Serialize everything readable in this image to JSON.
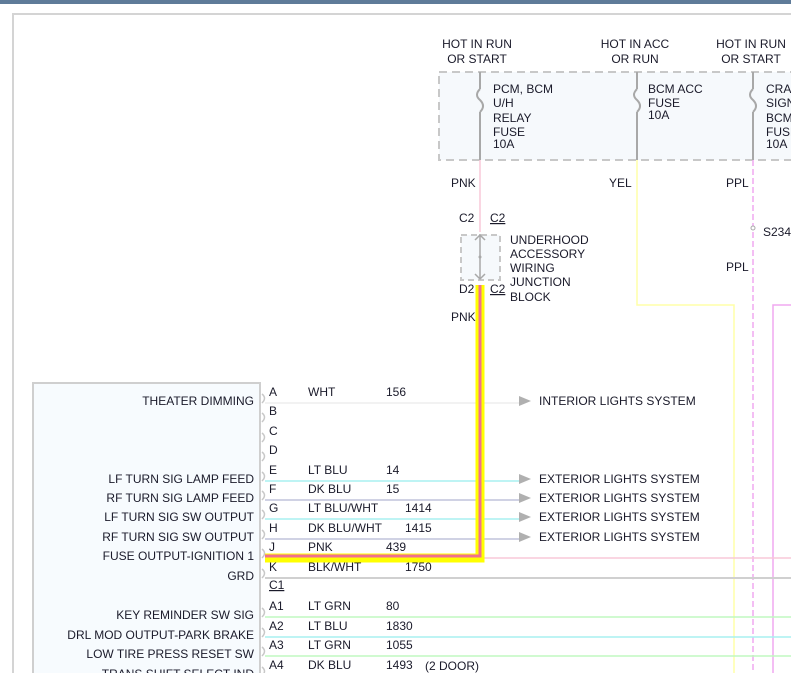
{
  "power_sources": [
    {
      "line1": "HOT IN RUN",
      "line2": "OR START"
    },
    {
      "line1": "HOT IN ACC",
      "line2": "OR RUN"
    },
    {
      "line1": "HOT IN RUN",
      "line2": "OR START"
    }
  ],
  "fuses": [
    {
      "lines": [
        "PCM, BCM",
        "U/H",
        "RELAY",
        "FUSE",
        "10A"
      ]
    },
    {
      "lines": [
        "BCM ACC",
        "FUSE",
        "10A"
      ]
    },
    {
      "lines": [
        "CRANK",
        "SIGNAL",
        "BCM",
        "FUSE",
        "10A"
      ]
    }
  ],
  "wire_labels": {
    "pnk_top": "PNK",
    "yel": "YEL",
    "ppl_top": "PPL",
    "splice": "S234",
    "ppl_bottom": "PPL",
    "pnk_bottom": "PNK"
  },
  "junction_block": {
    "conn_top_left": "C2",
    "conn_top_right": "C2",
    "conn_bottom_left": "D2",
    "conn_bottom_right": "C2",
    "name_lines": [
      "UNDERHOOD",
      "ACCESSORY",
      "WIRING",
      "JUNCTION",
      "BLOCK"
    ]
  },
  "module": {
    "pins": [
      {
        "pin": "A",
        "function": "THEATER DIMMING",
        "color": "WHT",
        "circuit": "156",
        "dest": "INTERIOR LIGHTS SYSTEM",
        "note": ""
      },
      {
        "pin": "B",
        "function": "",
        "color": "",
        "circuit": "",
        "dest": "",
        "note": ""
      },
      {
        "pin": "C",
        "function": "",
        "color": "",
        "circuit": "",
        "dest": "",
        "note": ""
      },
      {
        "pin": "D",
        "function": "",
        "color": "",
        "circuit": "",
        "dest": "",
        "note": ""
      },
      {
        "pin": "E",
        "function": "LF TURN SIG LAMP FEED",
        "color": "LT BLU",
        "circuit": "14",
        "dest": "EXTERIOR LIGHTS SYSTEM",
        "note": ""
      },
      {
        "pin": "F",
        "function": "RF TURN SIG LAMP FEED",
        "color": "DK BLU",
        "circuit": "15",
        "dest": "EXTERIOR LIGHTS SYSTEM",
        "note": ""
      },
      {
        "pin": "G",
        "function": "LF TURN SIG SW OUTPUT",
        "color": "LT BLU/WHT",
        "circuit": "1414",
        "dest": "EXTERIOR LIGHTS SYSTEM",
        "note": ""
      },
      {
        "pin": "H",
        "function": "RF TURN SIG SW OUTPUT",
        "color": "DK BLU/WHT",
        "circuit": "1415",
        "dest": "EXTERIOR LIGHTS SYSTEM",
        "note": ""
      },
      {
        "pin": "J",
        "function": "FUSE OUTPUT-IGNITION 1",
        "color": "PNK",
        "circuit": "439",
        "dest": "",
        "note": ""
      },
      {
        "pin": "K",
        "function": "GRD",
        "color": "BLK/WHT",
        "circuit": "1750",
        "dest": "",
        "note": ""
      },
      {
        "pin": "C1",
        "function": "",
        "color": "",
        "circuit": "",
        "dest": "",
        "note": ""
      },
      {
        "pin": "A1",
        "function": "KEY REMINDER SW SIG",
        "color": "LT GRN",
        "circuit": "80",
        "dest": "",
        "note": ""
      },
      {
        "pin": "A2",
        "function": "DRL MOD OUTPUT-PARK BRAKE",
        "color": "LT BLU",
        "circuit": "1830",
        "dest": "",
        "note": ""
      },
      {
        "pin": "A3",
        "function": "LOW TIRE PRESS RESET SW",
        "color": "LT GRN",
        "circuit": "1055",
        "dest": "",
        "note": ""
      },
      {
        "pin": "A4",
        "function": "TRANS SHIFT SELECT IND",
        "color": "DK BLU",
        "circuit": "1493",
        "dest": "",
        "note": "(2 DOOR)"
      }
    ]
  },
  "colors": {
    "highlight_outer": "#ffff00",
    "highlight_inner": "#f07090",
    "pnk": "#f8c8d8",
    "yel": "#ffffa0",
    "ppl": "#f0a0f0",
    "lt_blu": "#a8f0f0",
    "dk_blu": "#c0c4dc",
    "lt_grn": "#c0f8c0",
    "frame": "#d0d0d0",
    "topbar": "#5f7b99"
  }
}
